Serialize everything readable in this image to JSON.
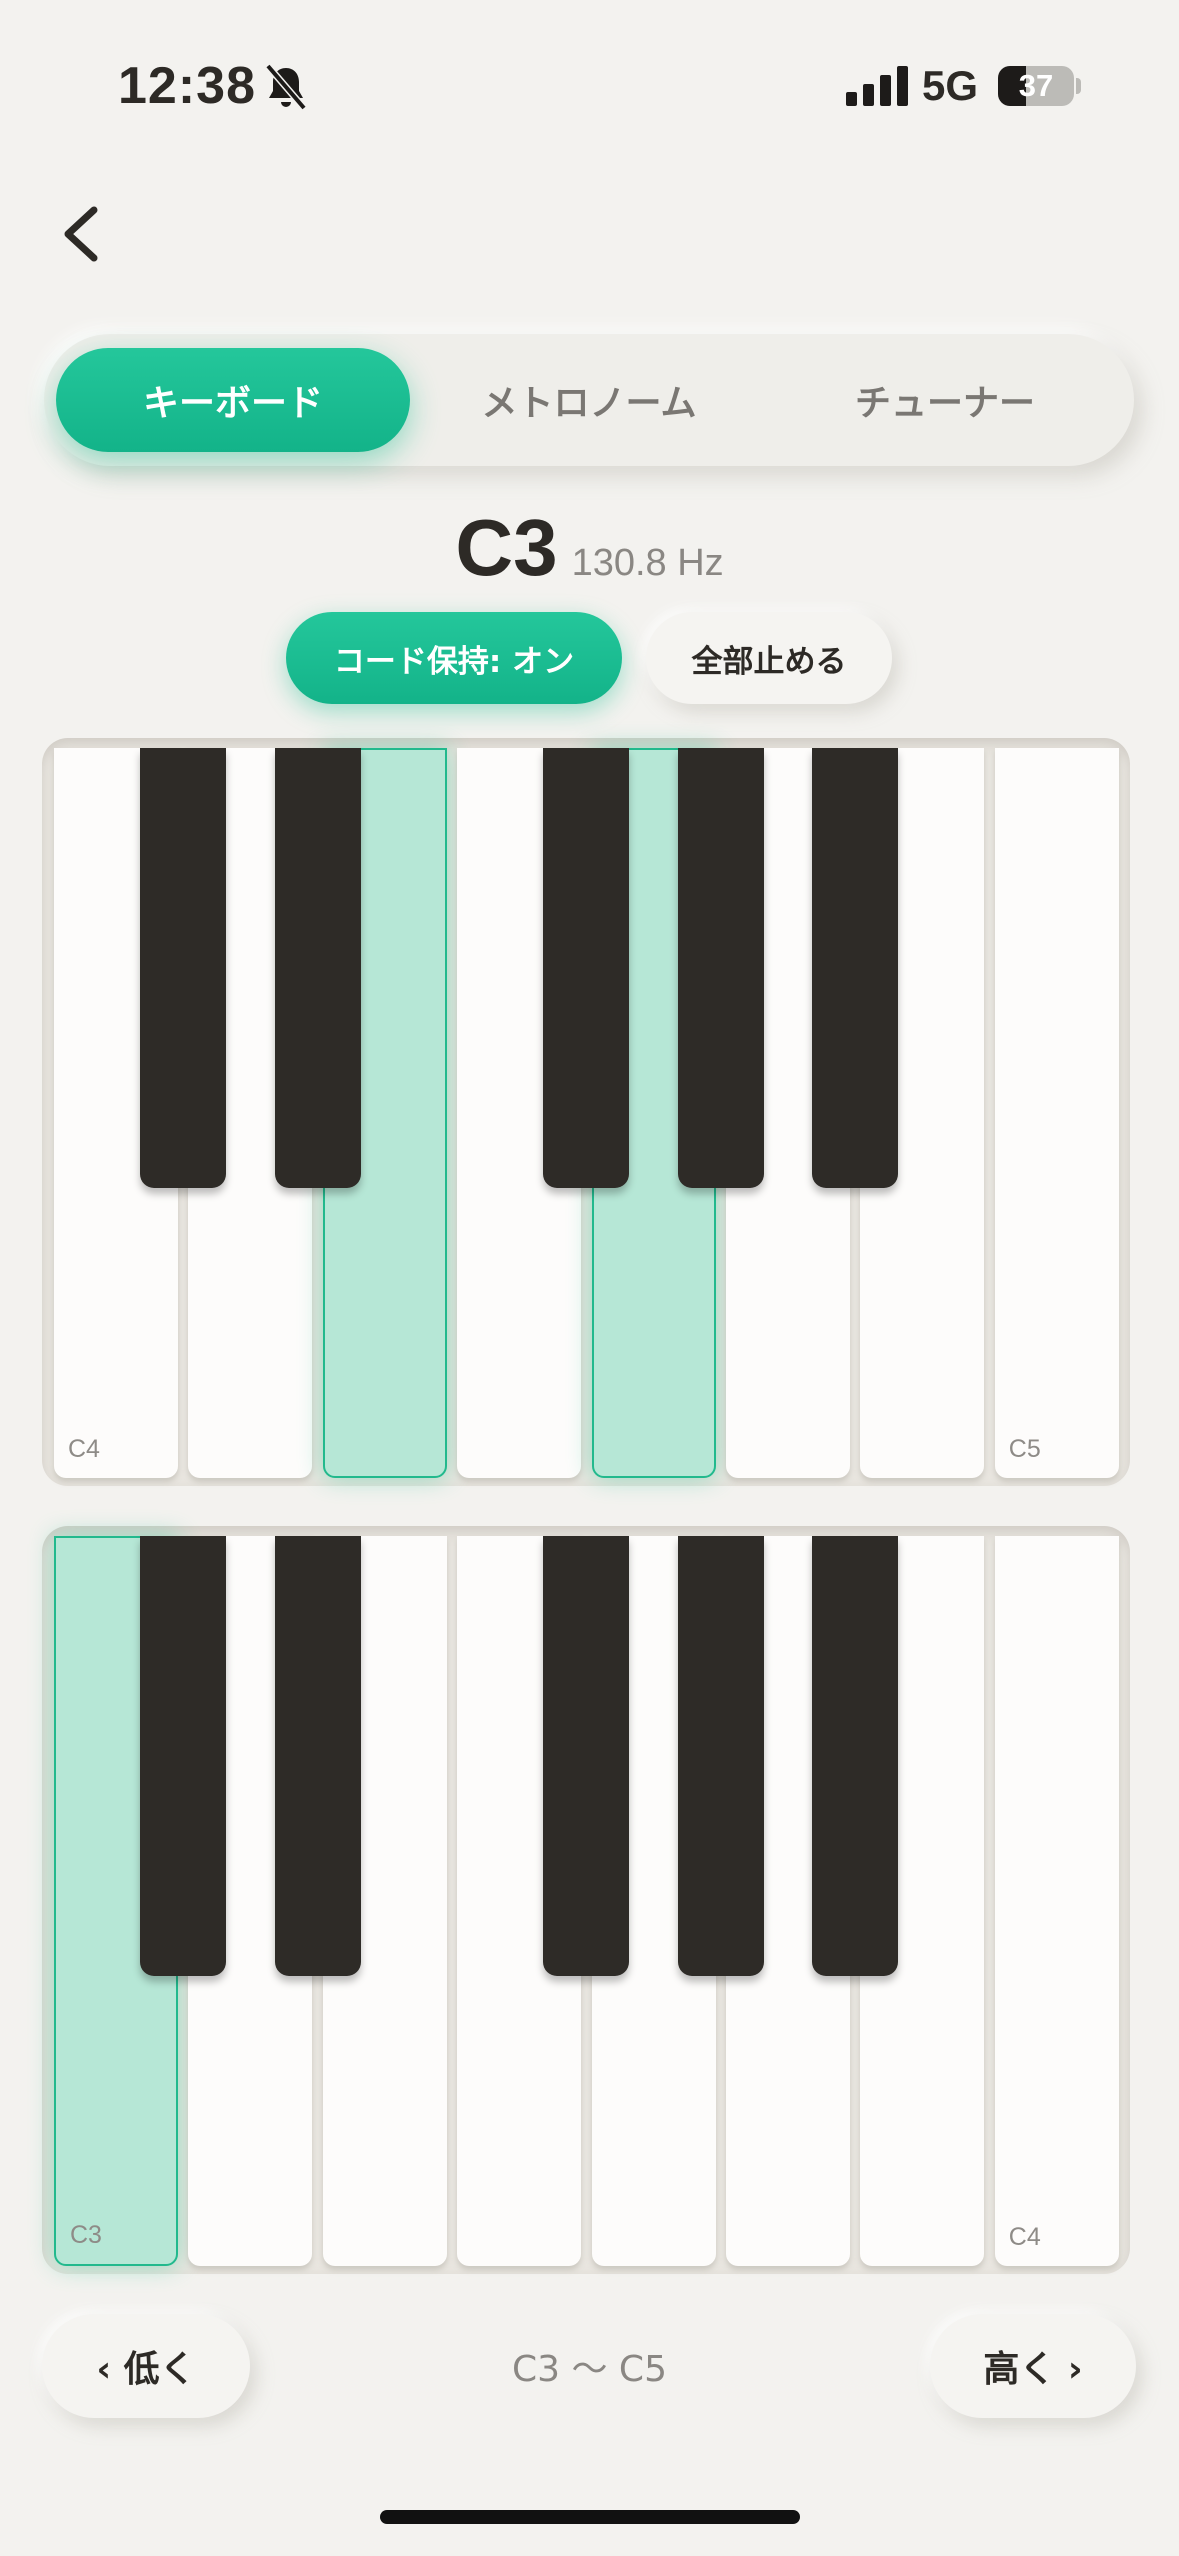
{
  "status": {
    "time": "12:38",
    "network": "5G",
    "battery": "37"
  },
  "tabs": [
    {
      "label": "キーボード",
      "active": true
    },
    {
      "label": "メトロノーム",
      "active": false
    },
    {
      "label": "チューナー",
      "active": false
    }
  ],
  "note": {
    "name": "C3",
    "frequency": "130.8 Hz"
  },
  "actions": {
    "hold_label": "コード保持: オン",
    "stop_label": "全部止める"
  },
  "keyboard_upper": {
    "start_label": "C4",
    "end_label": "C5",
    "active_white_keys": [
      2,
      4
    ]
  },
  "keyboard_lower": {
    "start_label": "C3",
    "end_label": "C4",
    "active_white_keys": [
      0
    ]
  },
  "nav": {
    "lower_label": "‹ 低く",
    "higher_label": "高く ›",
    "range_label": "C3 〜 C5"
  },
  "colors": {
    "accent": "#1bbd90",
    "active_key": "#b6e7d6",
    "black_key": "#2e2b27",
    "background": "#f3f2ef"
  }
}
